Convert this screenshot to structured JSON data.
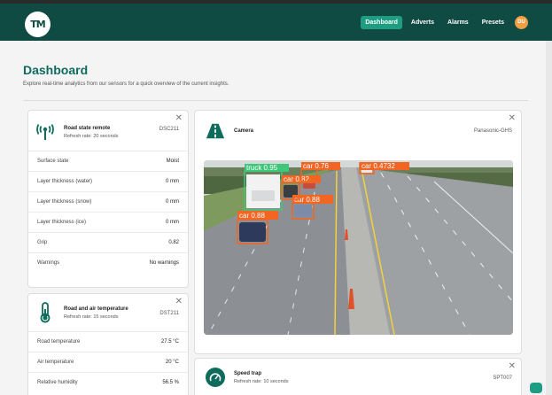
{
  "nav": {
    "logo": "TM",
    "items": [
      {
        "label": "Dashboard",
        "active": true
      },
      {
        "label": "Adverts",
        "active": false
      },
      {
        "label": "Alarms",
        "active": false
      },
      {
        "label": "Presets",
        "active": false
      }
    ],
    "avatar": "DU"
  },
  "page": {
    "title": "Dashboard",
    "description": "Explore real-time analytics from our sensors for a quick overview of the current insights."
  },
  "road_state": {
    "title": "Road state remote",
    "refresh": "Refresh rate: 20 seconds",
    "code": "DSC211",
    "icon": "antenna-icon",
    "rows": [
      {
        "label": "Surface state",
        "value": "Moist"
      },
      {
        "label": "Layer thickness (water)",
        "value": "0 mm"
      },
      {
        "label": "Layer thickness (snow)",
        "value": "0 mm"
      },
      {
        "label": "Layer thickness (ice)",
        "value": "0 mm"
      },
      {
        "label": "Grip",
        "value": "0.82"
      },
      {
        "label": "Warnings",
        "value": "No warnings"
      }
    ]
  },
  "road_temp": {
    "title": "Road and air temperature",
    "refresh": "Refresh rate: 15 seconds",
    "code": "DST211",
    "icon": "thermometer-icon",
    "rows": [
      {
        "label": "Road temperature",
        "value": "27.5 °C"
      },
      {
        "label": "Air temperature",
        "value": "20 °C"
      },
      {
        "label": "Relative humidity",
        "value": "56.5 %"
      }
    ]
  },
  "camera": {
    "title": "Camera",
    "code": "Panasonic-GHS",
    "icon": "road-icon",
    "detections": [
      {
        "label": "truck 0.95"
      },
      {
        "label": "car 0.76"
      },
      {
        "label": "car 0.82"
      },
      {
        "label": "car 0.88"
      },
      {
        "label": "car 0.88"
      },
      {
        "label": "car 0.4732"
      }
    ]
  },
  "speed_trap": {
    "title": "Speed trap",
    "refresh": "Refresh rate: 10 seconds",
    "code": "SPT007",
    "icon": "speedometer-icon"
  },
  "colors": {
    "brand": "#0f4a43",
    "accent": "#1f9d82",
    "title": "#0f6b5c",
    "detection_orange": "#f26522",
    "detection_green": "#3ec77a"
  }
}
